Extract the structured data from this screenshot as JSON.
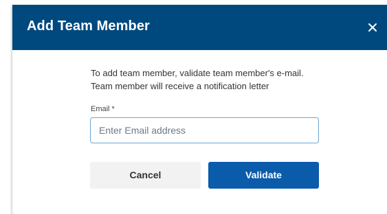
{
  "dialog": {
    "title": "Add Team Member",
    "close_icon": "close-icon",
    "description": "To add team member, validate team member's e-mail. Team member will receive a notification letter",
    "email_field": {
      "label": "Email *",
      "value": "",
      "placeholder": "Enter Email address"
    },
    "buttons": {
      "cancel_label": "Cancel",
      "validate_label": "Validate"
    }
  },
  "colors": {
    "header_bg": "#00497f",
    "primary_button": "#0a5cab",
    "secondary_button": "#f2f2f2",
    "input_border": "#6ba7d8"
  }
}
